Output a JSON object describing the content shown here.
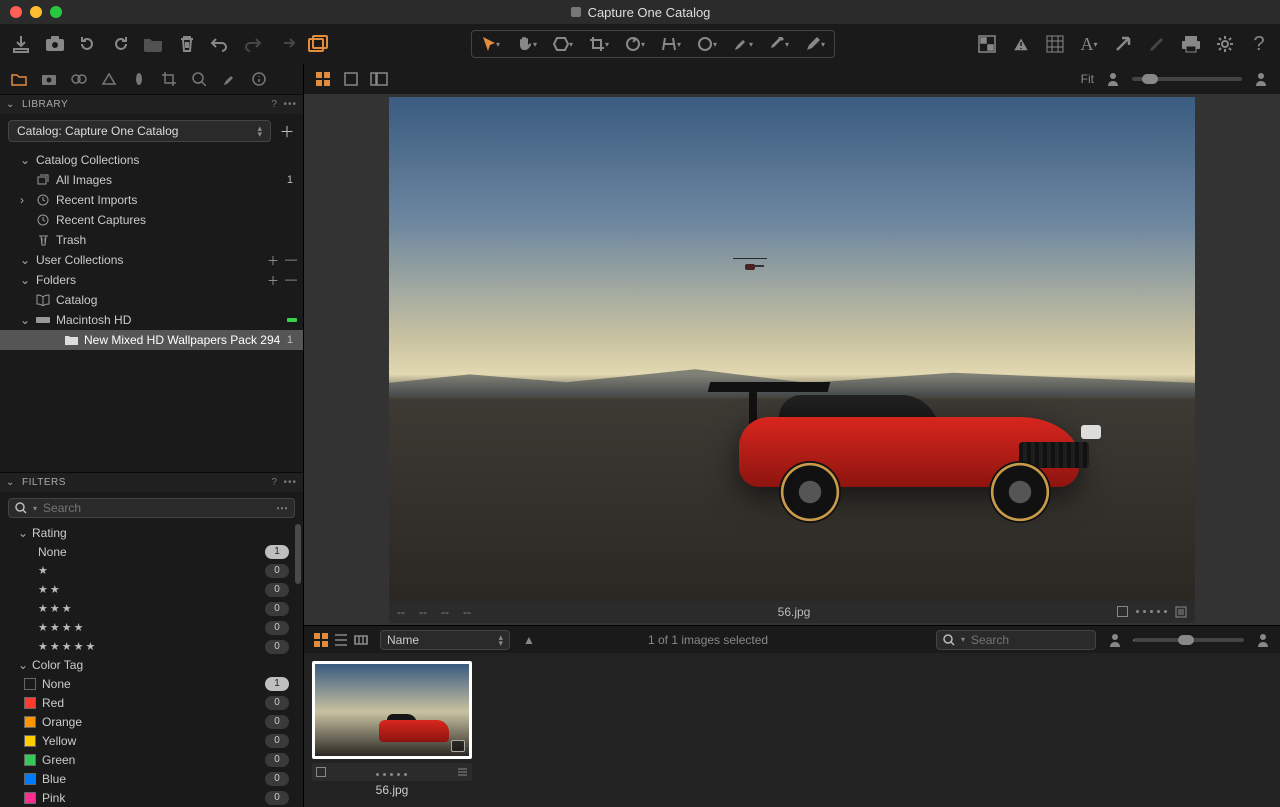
{
  "window": {
    "title": "Capture One Catalog"
  },
  "sidebar": {
    "library_label": "LIBRARY",
    "catalog_select": "Catalog: Capture One Catalog",
    "sections": {
      "catalog_collections": "Catalog Collections",
      "all_images": {
        "label": "All Images",
        "count": "1"
      },
      "recent_imports": "Recent Imports",
      "recent_captures": "Recent Captures",
      "trash": "Trash",
      "user_collections": "User Collections",
      "folders": "Folders",
      "catalog": "Catalog",
      "volume": "Macintosh HD",
      "folder_item": {
        "label": "New Mixed HD Wallpapers Pack 294",
        "count": "1"
      }
    },
    "filters_label": "FILTERS",
    "search_placeholder": "Search",
    "rating_label": "Rating",
    "ratings": {
      "none": {
        "label": "None",
        "count": "1"
      },
      "s1": {
        "stars": "★",
        "count": "0"
      },
      "s2": {
        "stars": "★★",
        "count": "0"
      },
      "s3": {
        "stars": "★★★",
        "count": "0"
      },
      "s4": {
        "stars": "★★★★",
        "count": "0"
      },
      "s5": {
        "stars": "★★★★★",
        "count": "0"
      }
    },
    "colortag_label": "Color Tag",
    "colortags": {
      "none": {
        "label": "None",
        "count": "1",
        "color": "transparent"
      },
      "red": {
        "label": "Red",
        "count": "0",
        "color": "#ff3b30"
      },
      "orange": {
        "label": "Orange",
        "count": "0",
        "color": "#ff9500"
      },
      "yellow": {
        "label": "Yellow",
        "count": "0",
        "color": "#ffcc00"
      },
      "green": {
        "label": "Green",
        "count": "0",
        "color": "#34c759"
      },
      "blue": {
        "label": "Blue",
        "count": "0",
        "color": "#007aff"
      },
      "pink": {
        "label": "Pink",
        "count": "0",
        "color": "#ff2d92"
      }
    }
  },
  "viewer": {
    "fit_label": "Fit",
    "filename": "56.jpg",
    "dash": "--"
  },
  "browser": {
    "sort_by": "Name",
    "selection_status": "1 of 1 images selected",
    "search_placeholder": "Search",
    "thumb_filename": "56.jpg"
  }
}
